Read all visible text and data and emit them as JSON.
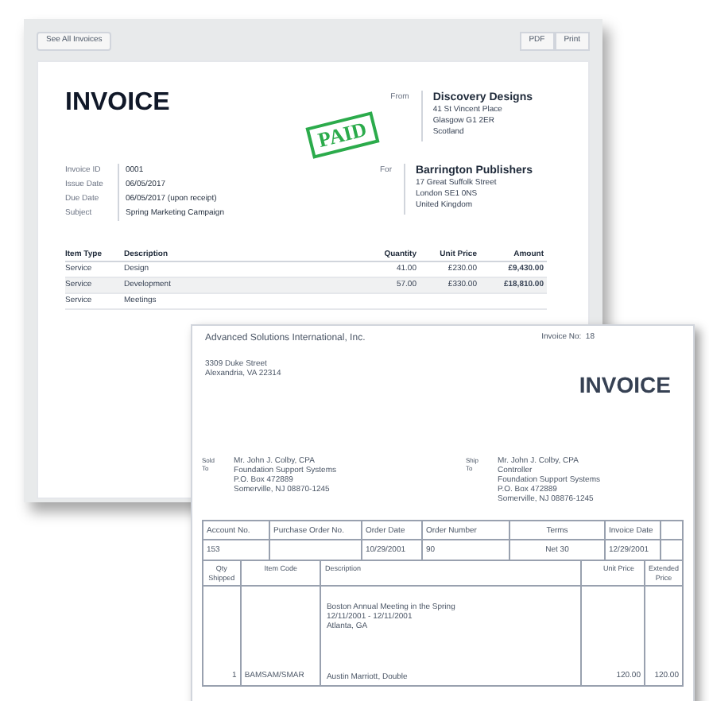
{
  "toolbar": {
    "back_button": "See All Invoices",
    "buttons": [
      "PDF",
      "Print"
    ]
  },
  "invoice": {
    "title": "INVOICE",
    "stamp": "PAID",
    "from": {
      "label": "From",
      "name": "Discovery Designs",
      "lines": [
        "41 St Vincent Place",
        "Glasgow G1 2ER",
        "Scotland"
      ]
    },
    "for": {
      "label": "For",
      "name": "Barrington Publishers",
      "lines": [
        "17 Great Suffolk Street",
        "London SE1 0NS",
        "United Kingdom"
      ]
    },
    "details": [
      {
        "label": "Invoice ID",
        "value": "0001"
      },
      {
        "label": "Issue Date",
        "value": "06/05/2017"
      },
      {
        "label": "Due Date",
        "value": "06/05/2017 (upon receipt)"
      },
      {
        "label": "Subject",
        "value": "Spring Marketing Campaign"
      }
    ],
    "table": {
      "columns": [
        "Item Type",
        "Description",
        "Quantity",
        "Unit Price",
        "Amount"
      ],
      "rows": [
        [
          "Service",
          "Design",
          "41.00",
          "£230.00",
          "£9,430.00"
        ],
        [
          "Service",
          "Development",
          "57.00",
          "£330.00",
          "£18,810.00"
        ],
        [
          "Service",
          "Meetings"
        ]
      ]
    }
  },
  "paper_invoice": {
    "company": "Advanced Solutions International, Inc.",
    "invoice_no": "Invoice No:  18",
    "address": [
      "3309 Duke Street",
      "Alexandria, VA 22314"
    ],
    "title": "INVOICE",
    "sold_to": {
      "label": [
        "Sold",
        "To"
      ],
      "lines": [
        "Mr. John J. Colby, CPA",
        "Foundation Support Systems",
        "P.O. Box 472889",
        "Somerville, NJ 08870-1245"
      ]
    },
    "ship_to": {
      "label": [
        "Ship",
        "To"
      ],
      "lines": [
        "Mr. John J. Colby, CPA",
        "Controller",
        "Foundation Support Systems",
        "P.O. Box 472889",
        "Somerville, NJ 08876-1245"
      ]
    },
    "order_table": {
      "columns": [
        "Account No.",
        "Purchase Order No.",
        "Order Date",
        "Order Number",
        "Terms",
        "Invoice Date"
      ],
      "row": {
        "account_no": "153",
        "order_date": "10/29/2001",
        "order_number": "90",
        "terms": "Net 30",
        "invoice_date": "12/29/2001"
      }
    },
    "item_table": {
      "columns": [
        "Qty Shipped",
        "Item Code",
        "Description",
        "Unit Price",
        "Extended Price"
      ],
      "row": {
        "qty": "1",
        "code": "BAMSAM/SMAR",
        "description": [
          "Boston Annual Meeting in the Spring",
          "12/11/2001 - 12/11/2001",
          "Atlanta, GA",
          "Austin Marriott, Double"
        ],
        "unit_price": "120.00",
        "extended_price": "120.00"
      }
    }
  }
}
